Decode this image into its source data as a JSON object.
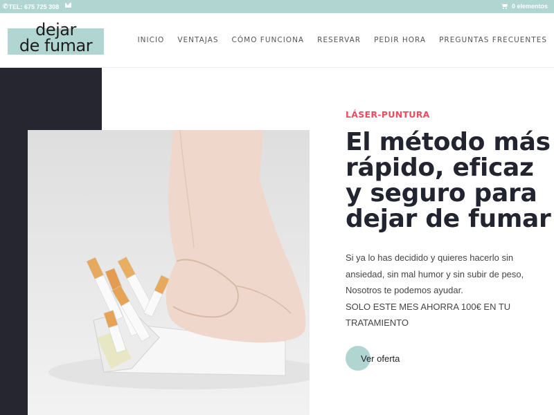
{
  "topbar": {
    "phone": "TEL: 675 725 308",
    "cart": "0 elementos"
  },
  "header": {
    "logo_line1": "dejar",
    "logo_line2": "de fumar",
    "nav": [
      "INICIO",
      "VENTAJAS",
      "CÓMO FUNCIONA",
      "RESERVAR",
      "PEDIR HORA",
      "PREGUNTAS FRECUENTES"
    ]
  },
  "hero": {
    "eyebrow": "LÁSER-PUNTURA",
    "headline": [
      "El método más",
      "rápido, eficaz",
      "y seguro para",
      "dejar de fumar"
    ],
    "body": [
      "Si ya lo has decidido y quieres hacerlo sin",
      "ansiedad, sin mal humor y sin subir de peso,",
      "Nosotros te podemos ayudar.",
      "SOLO ESTE MES AHORRA 100€ EN TU",
      "TRATAMIENTO"
    ],
    "cta_label": "Ver oferta"
  },
  "colors": {
    "accent": "#b1d6d2",
    "eyebrow": "#ef4b60",
    "dark": "#262631"
  }
}
